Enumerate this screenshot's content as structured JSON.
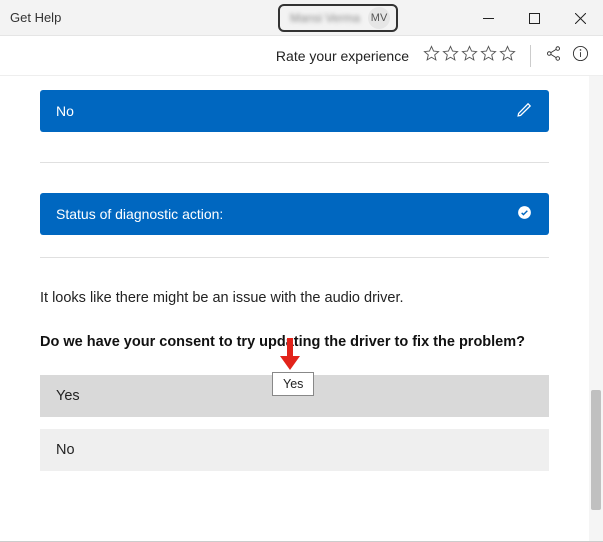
{
  "window": {
    "title": "Get Help",
    "user_name": "Mansi Verma",
    "user_initials": "MV"
  },
  "toolbar": {
    "rate_label": "Rate your experience"
  },
  "rows": {
    "no_label": "No",
    "status_label": "Status of diagnostic action:"
  },
  "message": {
    "issue": "It looks like there might be an issue with the audio driver.",
    "consent": "Do we have your consent to try updating the driver to fix the problem?"
  },
  "options": {
    "yes": "Yes",
    "no": "No"
  },
  "tooltip": {
    "text": "Yes"
  }
}
